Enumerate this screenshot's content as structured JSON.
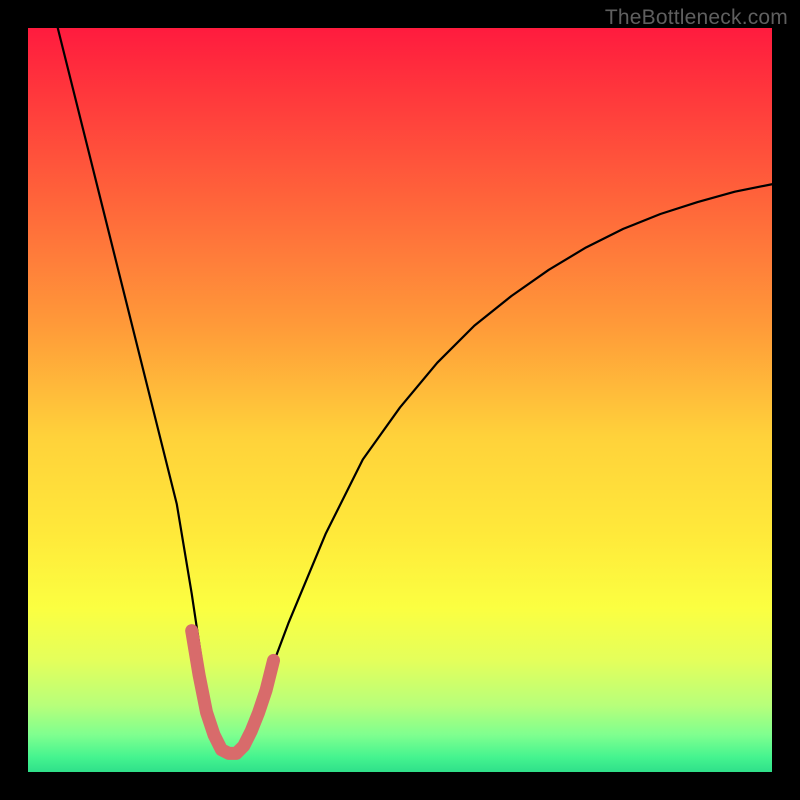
{
  "watermark": "TheBottleneck.com",
  "chart_data": {
    "type": "line",
    "title": "",
    "xlabel": "",
    "ylabel": "",
    "xlim": [
      0,
      100
    ],
    "ylim": [
      0,
      100
    ],
    "series": [
      {
        "name": "black-curve",
        "x": [
          4,
          6,
          8,
          10,
          12,
          14,
          16,
          18,
          20,
          22,
          23.5,
          25,
          26.5,
          28,
          30,
          32,
          35,
          40,
          45,
          50,
          55,
          60,
          65,
          70,
          75,
          80,
          85,
          90,
          95,
          100
        ],
        "values": [
          100,
          92,
          84,
          76,
          68,
          60,
          52,
          44,
          36,
          24,
          14,
          6,
          3,
          3,
          6,
          12,
          20,
          32,
          42,
          49,
          55,
          60,
          64,
          67.5,
          70.5,
          73,
          75,
          76.6,
          78,
          79
        ]
      },
      {
        "name": "highlight-curve",
        "x": [
          22,
          23,
          24,
          25,
          26,
          27,
          28,
          29,
          30,
          31,
          32,
          33
        ],
        "values": [
          19,
          13,
          8,
          5,
          3,
          2.5,
          2.5,
          3.5,
          5.5,
          8,
          11,
          15
        ]
      }
    ],
    "colors": {
      "black-curve": "#000000",
      "highlight-curve": "#d86b6b"
    }
  }
}
